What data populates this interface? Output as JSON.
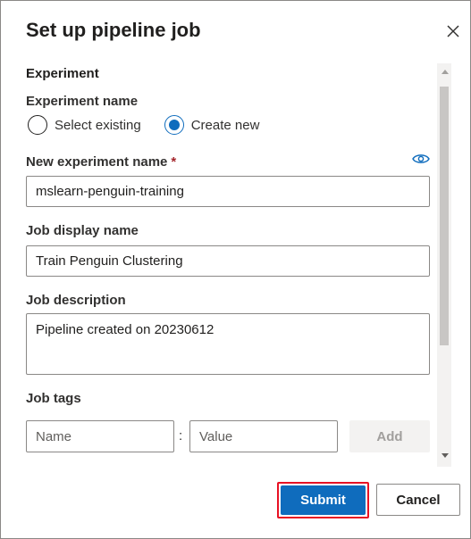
{
  "dialog": {
    "title": "Set up pipeline job"
  },
  "experiment": {
    "section_heading": "Experiment",
    "name_label": "Experiment name",
    "options": [
      "Select existing",
      "Create new"
    ],
    "selected_option": "Create new",
    "new_name_label": "New experiment name",
    "required_marker": "*",
    "new_name_value": "mslearn-penguin-training"
  },
  "job": {
    "display_name_label": "Job display name",
    "display_name_value": "Train Penguin Clustering",
    "description_label": "Job description",
    "description_value": "Pipeline created on 20230612",
    "tags_label": "Job tags",
    "tag_name_placeholder": "Name",
    "tag_separator": ":",
    "tag_value_placeholder": "Value",
    "add_label": "Add"
  },
  "footer": {
    "submit_label": "Submit",
    "cancel_label": "Cancel"
  },
  "colors": {
    "accent": "#0f6cbd",
    "highlight_outline": "#e81123",
    "required": "#a4262c"
  },
  "icons": {
    "close": "close-icon",
    "eye": "eye-icon",
    "scroll_up": "scroll-up-arrow-icon",
    "scroll_down": "scroll-down-arrow-icon"
  }
}
